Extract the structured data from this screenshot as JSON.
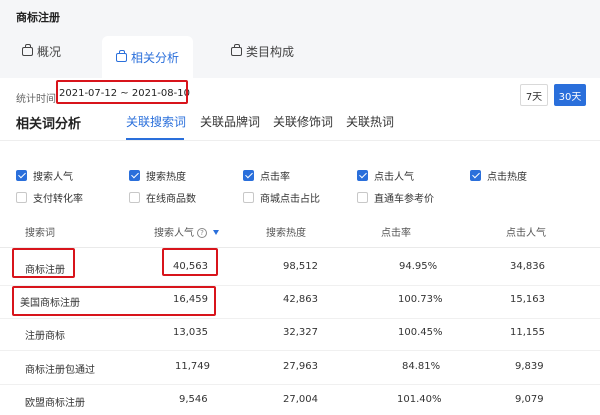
{
  "app_title": "商标注册",
  "tabs": [
    {
      "label": "概况",
      "icon": "bag-icon",
      "active": false
    },
    {
      "label": "相关分析",
      "icon": "bag-icon",
      "active": true
    },
    {
      "label": "类目构成",
      "icon": "bag-icon",
      "active": false
    }
  ],
  "stat": {
    "label": "统计时间",
    "range": "2021-07-12 ~ 2021-08-10"
  },
  "range_buttons": [
    {
      "label": "7天",
      "active": false
    },
    {
      "label": "30天",
      "active": true
    }
  ],
  "section": {
    "title": "相关词分析",
    "subtabs": [
      {
        "label": "关联搜索词",
        "active": true
      },
      {
        "label": "关联品牌词",
        "active": false
      },
      {
        "label": "关联修饰词",
        "active": false
      },
      {
        "label": "关联热词",
        "active": false
      }
    ]
  },
  "metrics": [
    {
      "label": "搜索人气",
      "checked": true
    },
    {
      "label": "搜索热度",
      "checked": true
    },
    {
      "label": "点击率",
      "checked": true
    },
    {
      "label": "点击人气",
      "checked": true
    },
    {
      "label": "点击热度",
      "checked": true
    },
    {
      "label": "支付转化率",
      "checked": false
    },
    {
      "label": "在线商品数",
      "checked": false
    },
    {
      "label": "商城点击占比",
      "checked": false
    },
    {
      "label": "直通车参考价",
      "checked": false
    }
  ],
  "table": {
    "headers": [
      "搜索词",
      "搜索人气",
      "搜索热度",
      "点击率",
      "点击人气"
    ],
    "rows": [
      [
        "商标注册",
        "40,563",
        "98,512",
        "94.95%",
        "34,836"
      ],
      [
        "美国商标注册",
        "16,459",
        "42,863",
        "100.73%",
        "15,163"
      ],
      [
        "注册商标",
        "13,035",
        "32,327",
        "100.45%",
        "11,155"
      ],
      [
        "商标注册包通过",
        "11,749",
        "27,963",
        "84.81%",
        "9,839"
      ],
      [
        "欧盟商标注册",
        "9,546",
        "27,004",
        "101.40%",
        "9,079"
      ]
    ]
  },
  "colors": {
    "accent": "#2a6fdb",
    "highlight": "#d8141b"
  }
}
